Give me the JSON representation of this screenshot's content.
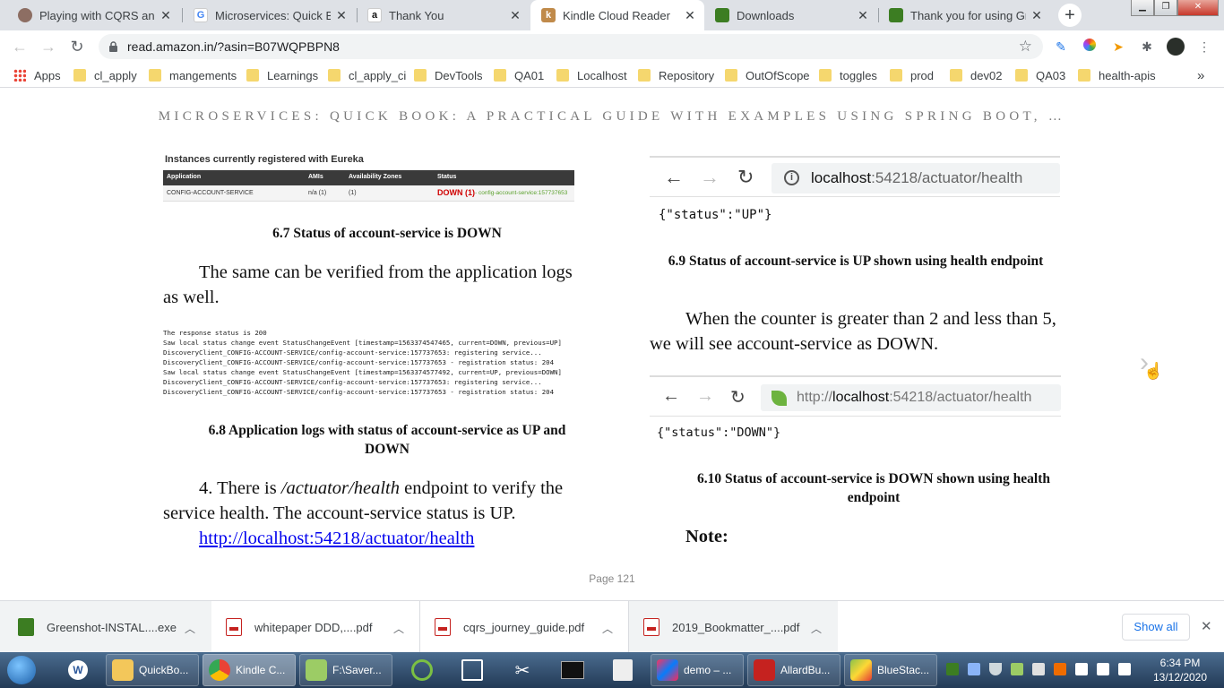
{
  "tabs": [
    {
      "title": "Playing with CQRS and E",
      "favicon": "avatar-icon",
      "active": false
    },
    {
      "title": "Microservices: Quick Boo",
      "favicon": "google-icon",
      "active": false
    },
    {
      "title": "Thank You",
      "favicon": "amazon-icon",
      "active": false
    },
    {
      "title": "Kindle Cloud Reader",
      "favicon": "kindle-icon",
      "active": true
    },
    {
      "title": "Downloads",
      "favicon": "greenshot-icon",
      "active": false
    },
    {
      "title": "Thank you for using Gre",
      "favicon": "greenshot-icon",
      "active": false
    }
  ],
  "address_bar": {
    "url": "read.amazon.in/?asin=B07WQPBPN8"
  },
  "bookmarks": [
    "Apps",
    "cl_apply",
    "mangements",
    "Learnings",
    "cl_apply_ci",
    "DevTools",
    "QA01",
    "Localhost",
    "Repository",
    "OutOfScope",
    "toggles",
    "prod",
    "dev02",
    "QA03",
    "health-apis"
  ],
  "book": {
    "title": "MICROSERVICES: QUICK BOOK: A PRACTICAL GUIDE WITH EXAMPLES USING SPRING BOOT, …",
    "page_label": "Page 121",
    "eureka_figure": {
      "header": "Instances currently registered with Eureka",
      "columns": [
        "Application",
        "AMIs",
        "Availability Zones",
        "Status"
      ],
      "row": {
        "application": "CONFIG-ACCOUNT-SERVICE",
        "amis": "n/a (1)",
        "zones": "(1)",
        "status_down": "DOWN (1)",
        "status_detail": " - config-account-service:157737653"
      }
    },
    "caption_6_7": "6.7 Status of account-service is DOWN",
    "para_logs": "The same can be verified from the application logs as well.",
    "logs": [
      "The response status is 200",
      "Saw local status change event StatusChangeEvent [timestamp=1563374547465, current=DOWN, previous=UP]",
      "DiscoveryClient_CONFIG-ACCOUNT-SERVICE/config-account-service:157737653: registering service...",
      "DiscoveryClient_CONFIG-ACCOUNT-SERVICE/config-account-service:157737653 - registration status: 204",
      "Saw local status change event StatusChangeEvent [timestamp=1563374577492, current=UP, previous=DOWN]",
      "DiscoveryClient_CONFIG-ACCOUNT-SERVICE/config-account-service:157737653: registering service...",
      "DiscoveryClient_CONFIG-ACCOUNT-SERVICE/config-account-service:157737653 - registration status: 204"
    ],
    "caption_6_8": "6.8 Application logs with status of account-service as UP and DOWN",
    "para_4_prefix": "4. There is ",
    "para_4_italic": "/actuator/health",
    "para_4_suffix": " endpoint to verify the service health. The account-service status is UP.",
    "health_link": "http://localhost:54218/actuator/health",
    "shot_up": {
      "host": "localhost",
      "rest": ":54218/actuator/health",
      "json": "{\"status\":\"UP\"}"
    },
    "caption_6_9": "6.9 Status of account-service is UP shown using health endpoint",
    "para_counter": "When the counter is greater than 2 and less than 5, we will see account-service as DOWN.",
    "shot_down": {
      "prefix": "http://",
      "host": "localhost",
      "rest": ":54218/actuator/health",
      "json": "{\"status\":\"DOWN\"}"
    },
    "caption_6_10": "6.10 Status of account-service is DOWN shown using health endpoint",
    "note": "Note:"
  },
  "downloads": [
    {
      "name": "Greenshot-INSTAL....exe",
      "icon": "greenshot-icon"
    },
    {
      "name": "whitepaper DDD,....pdf",
      "icon": "pdf-icon"
    },
    {
      "name": "cqrs_journey_guide.pdf",
      "icon": "pdf-icon"
    },
    {
      "name": "2019_Bookmatter_....pdf",
      "icon": "pdf-icon"
    }
  ],
  "show_all_label": "Show all",
  "taskbar": {
    "items": [
      {
        "label": "QuickBo...",
        "icon": "folder-icon"
      },
      {
        "label": "Kindle C...",
        "icon": "chrome-icon",
        "active": true
      },
      {
        "label": "F:\\Saver...",
        "icon": "notepad-icon"
      },
      {
        "label": "demo – ...",
        "icon": "intellij-icon"
      },
      {
        "label": "AllardBu...",
        "icon": "pdf-icon"
      },
      {
        "label": "BlueStac...",
        "icon": "bluestacks-icon"
      }
    ],
    "time": "6:34 PM",
    "date": "13/12/2020"
  },
  "colors": {
    "tabstrip": "#dee1e6",
    "link": "#0000ee",
    "down_red": "#d00000",
    "taskbar": "#2b4a6c"
  }
}
